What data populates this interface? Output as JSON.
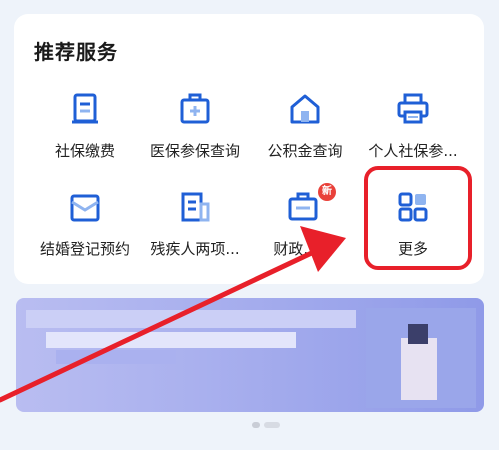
{
  "section": {
    "title": "推荐服务"
  },
  "services": [
    {
      "label": "社保缴费",
      "icon": "payment-doc-icon"
    },
    {
      "label": "医保参保查询",
      "icon": "medical-case-icon"
    },
    {
      "label": "公积金查询",
      "icon": "house-icon"
    },
    {
      "label": "个人社保参...",
      "icon": "printer-icon"
    },
    {
      "label": "结婚登记预约",
      "icon": "envelope-icon"
    },
    {
      "label": "残疾人两项...",
      "icon": "document-icon"
    },
    {
      "label": "财政...据",
      "icon": "briefcase-icon"
    },
    {
      "label": "更多",
      "icon": "grid-more-icon"
    }
  ],
  "badge": {
    "text": "新"
  },
  "colors": {
    "icon_blue": "#1f5fd6",
    "icon_light": "#8fb4f0",
    "highlight_red": "#e8202a",
    "arrow_red": "#e8202a"
  }
}
